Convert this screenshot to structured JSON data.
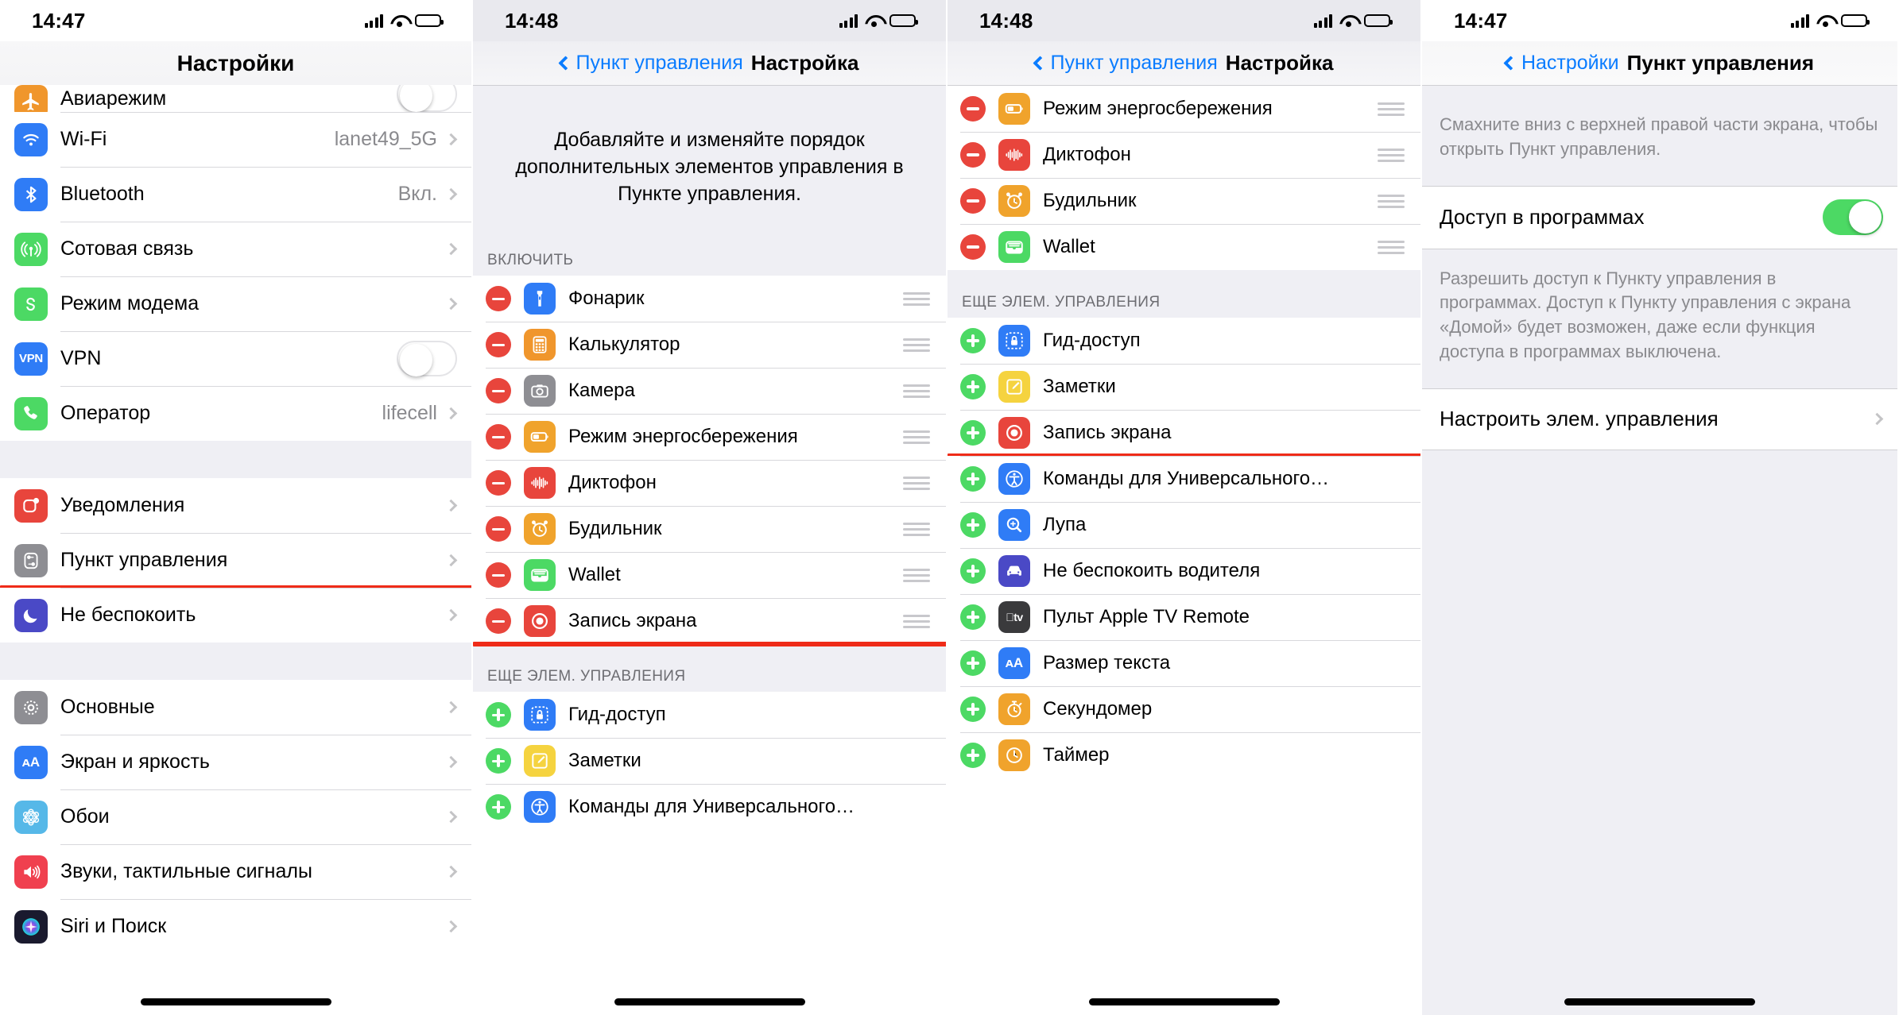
{
  "panels": [
    {
      "id": "settings-main",
      "status": {
        "time": "14:47",
        "battery_level": 60
      },
      "nav": {
        "title": "Настройки"
      },
      "rows": [
        {
          "label": "Авиарежим",
          "icon": "airplane-icon",
          "color": "#f0962c",
          "accessory": "toggle-off",
          "clipped": true
        },
        {
          "label": "Wi-Fi",
          "icon": "wifi-icon",
          "color": "#2f7cf6",
          "value": "lanet49_5G",
          "accessory": "chevron"
        },
        {
          "label": "Bluetooth",
          "icon": "bluetooth-icon",
          "color": "#2f7cf6",
          "value": "Вкл.",
          "accessory": "chevron"
        },
        {
          "label": "Сотовая связь",
          "icon": "cellular-icon",
          "color": "#4cd964",
          "value": "",
          "accessory": "chevron"
        },
        {
          "label": "Режим модема",
          "icon": "hotspot-icon",
          "color": "#4cd964",
          "value": "",
          "accessory": "chevron"
        },
        {
          "label": "VPN",
          "icon": "vpn-icon",
          "color": "#2f7cf6",
          "accessory": "toggle-off"
        },
        {
          "label": "Оператор",
          "icon": "phone-icon",
          "color": "#4cd964",
          "value": "lifecell",
          "accessory": "chevron"
        },
        {
          "gap": true
        },
        {
          "label": "Уведомления",
          "icon": "notifications-icon",
          "color": "#e8453c",
          "value": "",
          "accessory": "chevron"
        },
        {
          "label": "Пункт управления",
          "icon": "control-center-icon",
          "color": "#8e8e93",
          "value": "",
          "accessory": "chevron",
          "highlighted": true
        },
        {
          "label": "Не беспокоить",
          "icon": "moon-icon",
          "color": "#4a49c6",
          "value": "",
          "accessory": "chevron"
        },
        {
          "gap": true
        },
        {
          "label": "Основные",
          "icon": "gear-icon",
          "color": "#8e8e93",
          "value": "",
          "accessory": "chevron"
        },
        {
          "label": "Экран и яркость",
          "icon": "display-icon",
          "color": "#2f7cf6",
          "value": "",
          "accessory": "chevron"
        },
        {
          "label": "Обои",
          "icon": "wallpaper-icon",
          "color": "#56b8e8",
          "value": "",
          "accessory": "chevron"
        },
        {
          "label": "Звуки, тактильные сигналы",
          "icon": "sounds-icon",
          "color": "#f0404f",
          "value": "",
          "accessory": "chevron"
        },
        {
          "label": "Siri и Поиск",
          "icon": "siri-icon",
          "color": "#1a1a2e",
          "value": "",
          "accessory": "chevron"
        }
      ]
    },
    {
      "id": "customize-controls-top",
      "status": {
        "time": "14:48",
        "battery_level": 60
      },
      "nav": {
        "back": "Пункт управления",
        "title": "Настройка"
      },
      "description": "Добавляйте и изменяйте порядок дополнительных элементов управления в Пункте управления.",
      "section_include": "ВКЛЮЧИТЬ",
      "included": [
        {
          "label": "Фонарик",
          "icon": "flashlight-icon",
          "color": "#2f7cf6"
        },
        {
          "label": "Калькулятор",
          "icon": "calculator-icon",
          "color": "#f0962c"
        },
        {
          "label": "Камера",
          "icon": "camera-icon",
          "color": "#8e8e93"
        },
        {
          "label": "Режим энергосбережения",
          "icon": "battery-icon",
          "color": "#f0a32c"
        },
        {
          "label": "Диктофон",
          "icon": "voice-memos-icon",
          "color": "#e8453c"
        },
        {
          "label": "Будильник",
          "icon": "alarm-icon",
          "color": "#f0a32c"
        },
        {
          "label": "Wallet",
          "icon": "wallet-icon",
          "color": "#4cd964"
        },
        {
          "label": "Запись экрана",
          "icon": "screen-record-icon",
          "color": "#e8453c",
          "highlighted": true
        }
      ],
      "section_more": "ЕЩЕ ЭЛЕМ. УПРАВЛЕНИЯ",
      "more": [
        {
          "label": "Гид-доступ",
          "icon": "guided-access-icon",
          "color": "#2f7cf6"
        },
        {
          "label": "Заметки",
          "icon": "notes-icon",
          "color": "#f5d33f"
        },
        {
          "label": "Команды для Универсального…",
          "icon": "accessibility-icon",
          "color": "#2f7cf6"
        }
      ]
    },
    {
      "id": "customize-controls-scrolled",
      "status": {
        "time": "14:48",
        "battery_level": 60
      },
      "nav": {
        "back": "Пункт управления",
        "title": "Настройка"
      },
      "included": [
        {
          "label": "Режим энергосбережения",
          "icon": "battery-icon",
          "color": "#f0a32c"
        },
        {
          "label": "Диктофон",
          "icon": "voice-memos-icon",
          "color": "#e8453c"
        },
        {
          "label": "Будильник",
          "icon": "alarm-icon",
          "color": "#f0a32c"
        },
        {
          "label": "Wallet",
          "icon": "wallet-icon",
          "color": "#4cd964"
        }
      ],
      "section_more": "ЕЩЕ ЭЛЕМ. УПРАВЛЕНИЯ",
      "more": [
        {
          "label": "Гид-доступ",
          "icon": "guided-access-icon",
          "color": "#2f7cf6"
        },
        {
          "label": "Заметки",
          "icon": "notes-icon",
          "color": "#f5d33f"
        },
        {
          "label": "Запись экрана",
          "icon": "screen-record-icon",
          "color": "#e8453c",
          "highlighted": true
        },
        {
          "label": "Команды для Универсального…",
          "icon": "accessibility-icon",
          "color": "#2f7cf6"
        },
        {
          "label": "Лупа",
          "icon": "magnifier-icon",
          "color": "#2f7cf6"
        },
        {
          "label": "Не беспокоить водителя",
          "icon": "car-icon",
          "color": "#4a49c6"
        },
        {
          "label": "Пульт Apple TV Remote",
          "icon": "apple-tv-remote-icon",
          "color": "#3a3a3c"
        },
        {
          "label": "Размер текста",
          "icon": "text-size-icon",
          "color": "#2f7cf6"
        },
        {
          "label": "Секундомер",
          "icon": "stopwatch-icon",
          "color": "#f0a32c"
        },
        {
          "label": "Таймер",
          "icon": "timer-icon",
          "color": "#f0a32c"
        }
      ]
    },
    {
      "id": "control-center-settings",
      "status": {
        "time": "14:47",
        "battery_level": 60
      },
      "nav": {
        "back": "Настройки",
        "title": "Пункт управления"
      },
      "hint_top": "Смахните вниз с верхней правой части экрана, чтобы открыть Пункт управления.",
      "access_row": {
        "label": "Доступ в программах",
        "toggle": "on"
      },
      "hint_bottom": "Разрешить доступ к Пункту управления в программах. Доступ к Пункту управления с экрана «Домой» будет возможен, даже если функция доступа в программах выключена.",
      "customize_row": {
        "label": "Настроить элем. управления",
        "accessory": "chevron"
      }
    }
  ],
  "colors": {
    "accent": "#0a7cff",
    "highlight": "#ef2b18",
    "toggle_on": "#4cd964",
    "group_bg": "#efeff4"
  }
}
